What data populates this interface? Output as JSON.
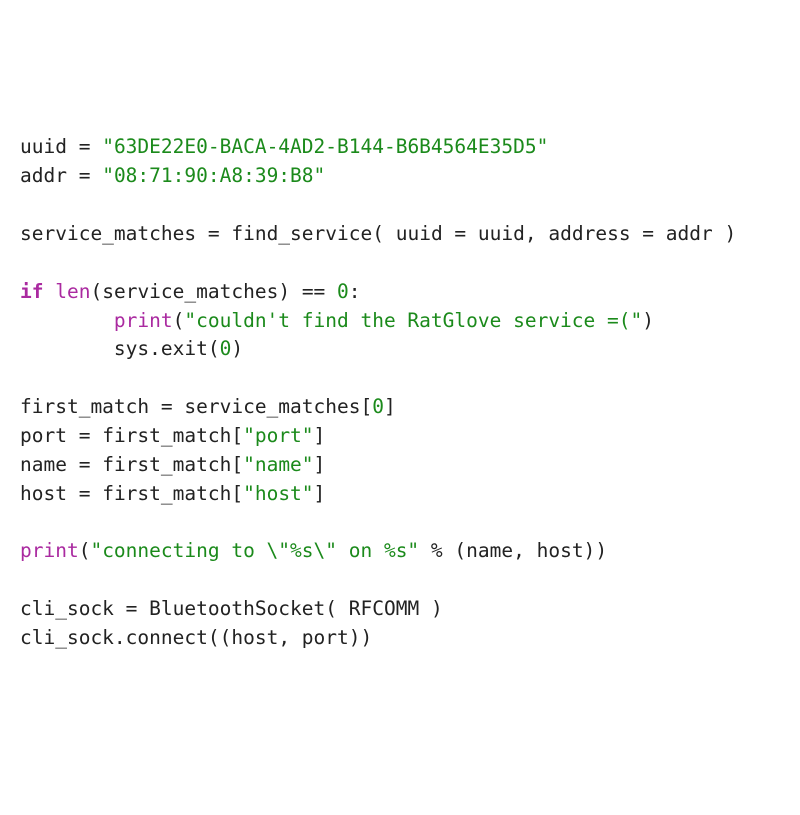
{
  "code": {
    "line1": {
      "var": "uuid",
      "op": " = ",
      "str": "\"63DE22E0-BACA-4AD2-B144-B6B4564E35D5\""
    },
    "line2": {
      "var": "addr",
      "op": " = ",
      "str": "\"08:71:90:A8:39:B8\""
    },
    "line4": {
      "lhs": "service_matches",
      "op": " = ",
      "func": "find_service",
      "open": "( ",
      "k1": "uuid",
      "eq1": " = ",
      "v1": "uuid",
      "sep": ", ",
      "k2": "address",
      "eq2": " = ",
      "v2": "addr",
      "close": " )"
    },
    "line6": {
      "kw": "if",
      "sp": " ",
      "builtin": "len",
      "open": "(",
      "arg": "service_matches",
      "close": ")",
      "op": " == ",
      "num": "0",
      "colon": ":"
    },
    "line7": {
      "indent": "        ",
      "builtin": "print",
      "open": "(",
      "str": "\"couldn't find the RatGlove service =(\"",
      "close": ")"
    },
    "line8": {
      "indent": "        ",
      "mod": "sys",
      "dot": ".",
      "func": "exit",
      "open": "(",
      "num": "0",
      "close": ")"
    },
    "line10": {
      "lhs": "first_match",
      "op": " = ",
      "rhs": "service_matches",
      "open": "[",
      "num": "0",
      "close": "]"
    },
    "line11": {
      "lhs": "port",
      "op": " = ",
      "rhs": "first_match",
      "open": "[",
      "str": "\"port\"",
      "close": "]"
    },
    "line12": {
      "lhs": "name",
      "op": " = ",
      "rhs": "first_match",
      "open": "[",
      "str": "\"name\"",
      "close": "]"
    },
    "line13": {
      "lhs": "host",
      "op": " = ",
      "rhs": "first_match",
      "open": "[",
      "str": "\"host\"",
      "close": "]"
    },
    "line15": {
      "builtin": "print",
      "open": "(",
      "str": "\"connecting to \\\"%s\\\" on %s\"",
      "op": " % ",
      "args": "(name, host)",
      "close": ")"
    },
    "line17": {
      "lhs": "cli_sock",
      "op": " = ",
      "cls": "BluetoothSocket",
      "open": "( ",
      "arg": "RFCOMM",
      "close": " )"
    },
    "line18": {
      "obj": "cli_sock",
      "dot": ".",
      "method": "connect",
      "open": "((",
      "a1": "host",
      "sep": ", ",
      "a2": "port",
      "close": "))"
    }
  }
}
